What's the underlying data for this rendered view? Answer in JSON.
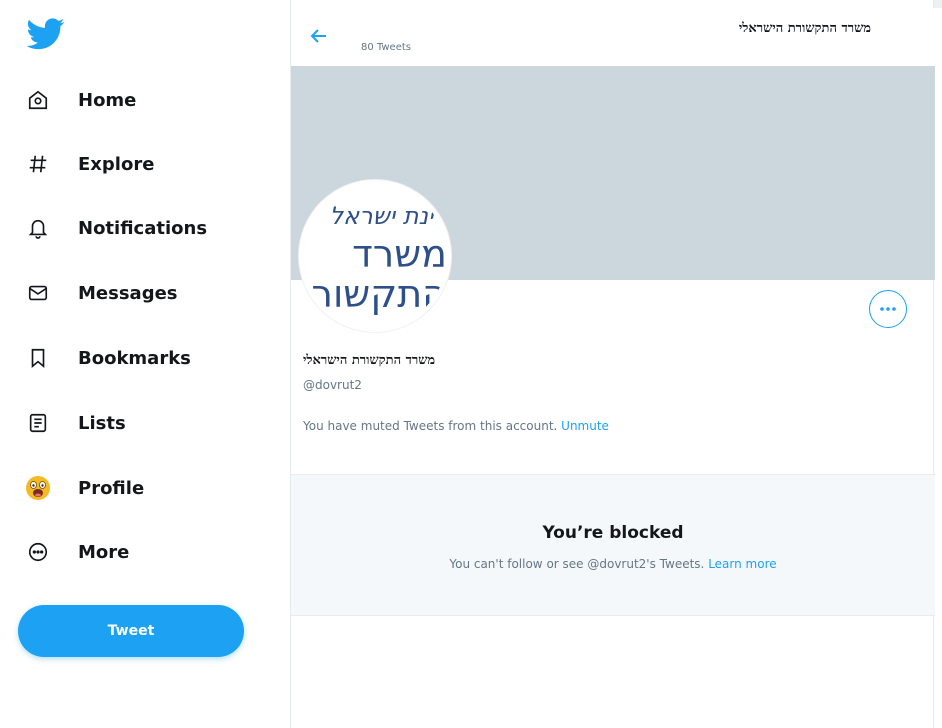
{
  "sidebar": {
    "logo": "twitter-bird-logo",
    "items": [
      {
        "label": "Home",
        "icon": "home-icon"
      },
      {
        "label": "Explore",
        "icon": "hashtag-icon"
      },
      {
        "label": "Notifications",
        "icon": "bell-icon"
      },
      {
        "label": "Messages",
        "icon": "envelope-icon"
      },
      {
        "label": "Bookmarks",
        "icon": "bookmark-icon"
      },
      {
        "label": "Lists",
        "icon": "list-icon"
      },
      {
        "label": "Profile",
        "icon": "avatar-emoji-icon"
      },
      {
        "label": "More",
        "icon": "more-circle-icon"
      }
    ],
    "tweet_button": "Tweet"
  },
  "header": {
    "title": "משרד התקשורת הישראלי",
    "tweet_count": "80 Tweets"
  },
  "profile": {
    "avatar_text": {
      "line1": "רינת ישראל",
      "line2": "משרד",
      "line3": "התקשורת"
    },
    "name": "משרד התקשורת הישראלי",
    "handle": "@dovrut2",
    "muted_message": "You have muted Tweets from this account.",
    "unmute_label": "Unmute"
  },
  "blocked": {
    "title": "You’re blocked",
    "description": "You can't follow or see @dovrut2's Tweets.",
    "learn_more": "Learn more"
  },
  "colors": {
    "accent": "#1da1f2",
    "banner": "#ccd6dd",
    "blocked_bg": "#f5f8fa",
    "secondary_text": "#657786"
  }
}
